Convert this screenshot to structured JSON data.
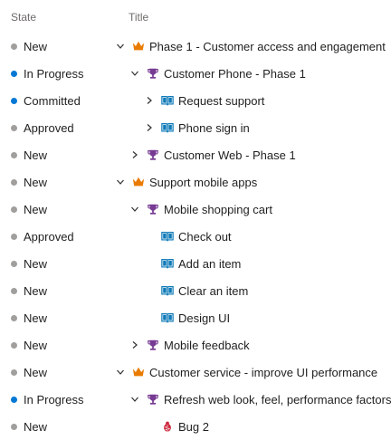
{
  "colors": {
    "new": "#a19f9d",
    "in_progress": "#0078d4",
    "committed": "#0078d4",
    "approved": "#a19f9d",
    "epic": "#e97b00",
    "feature": "#773b93",
    "story": "#0f7ab8",
    "bug": "#cc293d"
  },
  "header": {
    "state": "State",
    "title": "Title"
  },
  "rows": [
    {
      "state": "New",
      "status": "new",
      "level": 0,
      "expander": "expanded",
      "type": "epic",
      "icon": "crown-icon",
      "title": "Phase 1 - Customer access and engagement"
    },
    {
      "state": "In Progress",
      "status": "in_progress",
      "level": 1,
      "expander": "expanded",
      "type": "feature",
      "icon": "trophy-icon",
      "title": "Customer Phone - Phase 1"
    },
    {
      "state": "Committed",
      "status": "committed",
      "level": 2,
      "expander": "collapsed",
      "type": "story",
      "icon": "book-icon",
      "title": "Request support"
    },
    {
      "state": "Approved",
      "status": "approved",
      "level": 2,
      "expander": "collapsed",
      "type": "story",
      "icon": "book-icon",
      "title": "Phone sign in"
    },
    {
      "state": "New",
      "status": "new",
      "level": 1,
      "expander": "collapsed",
      "type": "feature",
      "icon": "trophy-icon",
      "title": "Customer Web - Phase 1"
    },
    {
      "state": "New",
      "status": "new",
      "level": 0,
      "expander": "expanded",
      "type": "epic",
      "icon": "crown-icon",
      "title": "Support mobile apps"
    },
    {
      "state": "New",
      "status": "new",
      "level": 1,
      "expander": "expanded",
      "type": "feature",
      "icon": "trophy-icon",
      "title": "Mobile shopping cart"
    },
    {
      "state": "Approved",
      "status": "approved",
      "level": 2,
      "expander": "none",
      "type": "story",
      "icon": "book-icon",
      "title": "Check out"
    },
    {
      "state": "New",
      "status": "new",
      "level": 2,
      "expander": "none",
      "type": "story",
      "icon": "book-icon",
      "title": "Add an item"
    },
    {
      "state": "New",
      "status": "new",
      "level": 2,
      "expander": "none",
      "type": "story",
      "icon": "book-icon",
      "title": "Clear an item"
    },
    {
      "state": "New",
      "status": "new",
      "level": 2,
      "expander": "none",
      "type": "story",
      "icon": "book-icon",
      "title": "Design UI"
    },
    {
      "state": "New",
      "status": "new",
      "level": 1,
      "expander": "collapsed",
      "type": "feature",
      "icon": "trophy-icon",
      "title": "Mobile feedback"
    },
    {
      "state": "New",
      "status": "new",
      "level": 0,
      "expander": "expanded",
      "type": "epic",
      "icon": "crown-icon",
      "title": "Customer service - improve UI performance"
    },
    {
      "state": "In Progress",
      "status": "in_progress",
      "level": 1,
      "expander": "expanded",
      "type": "feature",
      "icon": "trophy-icon",
      "title": "Refresh web look, feel, performance factors"
    },
    {
      "state": "New",
      "status": "new",
      "level": 2,
      "expander": "none",
      "type": "bug",
      "icon": "bug-icon",
      "title": "Bug 2"
    }
  ]
}
